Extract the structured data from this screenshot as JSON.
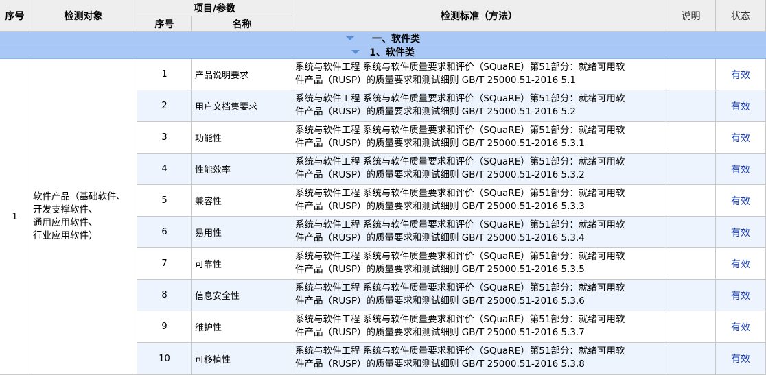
{
  "header": {
    "seq": "序号",
    "object": "检测对象",
    "params": "项目/参数",
    "sub_seq": "序号",
    "sub_name": "名称",
    "standard": "检测标准（方法）",
    "note": "说明",
    "status": "状态"
  },
  "groups": [
    {
      "label": "一、软件类"
    },
    {
      "label": "1、软件类"
    }
  ],
  "row_group": {
    "seq": "1",
    "object_lines": [
      "软件产品（基础软件、",
      "开发支撑软件、",
      "通用应用软件、",
      "行业应用软件）"
    ]
  },
  "rows": [
    {
      "no": "1",
      "name": "产品说明要求",
      "std1": "系统与软件工程 系统与软件质量要求和评价（SQuaRE）第51部分：就绪可用软",
      "std2": "件产品（RUSP）的质量要求和测试细则 GB/T 25000.51-2016 5.1",
      "note": "",
      "status": "有效"
    },
    {
      "no": "2",
      "name": "用户文档集要求",
      "std1": "系统与软件工程 系统与软件质量要求和评价（SQuaRE）第51部分：就绪可用软",
      "std2": "件产品（RUSP）的质量要求和测试细则 GB/T 25000.51-2016 5.2",
      "note": "",
      "status": "有效"
    },
    {
      "no": "3",
      "name": "功能性",
      "std1": "系统与软件工程 系统与软件质量要求和评价（SQuaRE）第51部分：就绪可用软",
      "std2": "件产品（RUSP）的质量要求和测试细则 GB/T 25000.51-2016 5.3.1",
      "note": "",
      "status": "有效"
    },
    {
      "no": "4",
      "name": "性能效率",
      "std1": "系统与软件工程 系统与软件质量要求和评价（SQuaRE）第51部分：就绪可用软",
      "std2": "件产品（RUSP）的质量要求和测试细则 GB/T 25000.51-2016 5.3.2",
      "note": "",
      "status": "有效"
    },
    {
      "no": "5",
      "name": "兼容性",
      "std1": "系统与软件工程 系统与软件质量要求和评价（SQuaRE）第51部分：就绪可用软",
      "std2": "件产品（RUSP）的质量要求和测试细则 GB/T 25000.51-2016 5.3.3",
      "note": "",
      "status": "有效"
    },
    {
      "no": "6",
      "name": "易用性",
      "std1": "系统与软件工程 系统与软件质量要求和评价（SQuaRE）第51部分：就绪可用软",
      "std2": "件产品（RUSP）的质量要求和测试细则 GB/T 25000.51-2016 5.3.4",
      "note": "",
      "status": "有效"
    },
    {
      "no": "7",
      "name": "可靠性",
      "std1": "系统与软件工程 系统与软件质量要求和评价（SQuaRE）第51部分：就绪可用软",
      "std2": "件产品（RUSP）的质量要求和测试细则 GB/T 25000.51-2016 5.3.5",
      "note": "",
      "status": "有效"
    },
    {
      "no": "8",
      "name": "信息安全性",
      "std1": "系统与软件工程 系统与软件质量要求和评价（SQuaRE）第51部分：就绪可用软",
      "std2": "件产品（RUSP）的质量要求和测试细则 GB/T 25000.51-2016 5.3.6",
      "note": "",
      "status": "有效"
    },
    {
      "no": "9",
      "name": "维护性",
      "std1": "系统与软件工程 系统与软件质量要求和评价（SQuaRE）第51部分：就绪可用软",
      "std2": "件产品（RUSP）的质量要求和测试细则 GB/T 25000.51-2016 5.3.7",
      "note": "",
      "status": "有效"
    },
    {
      "no": "10",
      "name": "可移植性",
      "std1": "系统与软件工程 系统与软件质量要求和评价（SQuaRE）第51部分：就绪可用软",
      "std2": "件产品（RUSP）的质量要求和测试细则 GB/T 25000.51-2016 5.3.8",
      "note": "",
      "status": "有效"
    }
  ],
  "colors": {
    "header_bg": "#eeeeee",
    "group_bg": "#a9c8f5",
    "alt_row_bg": "#eef4fd",
    "status_link": "#1a3fb5"
  }
}
